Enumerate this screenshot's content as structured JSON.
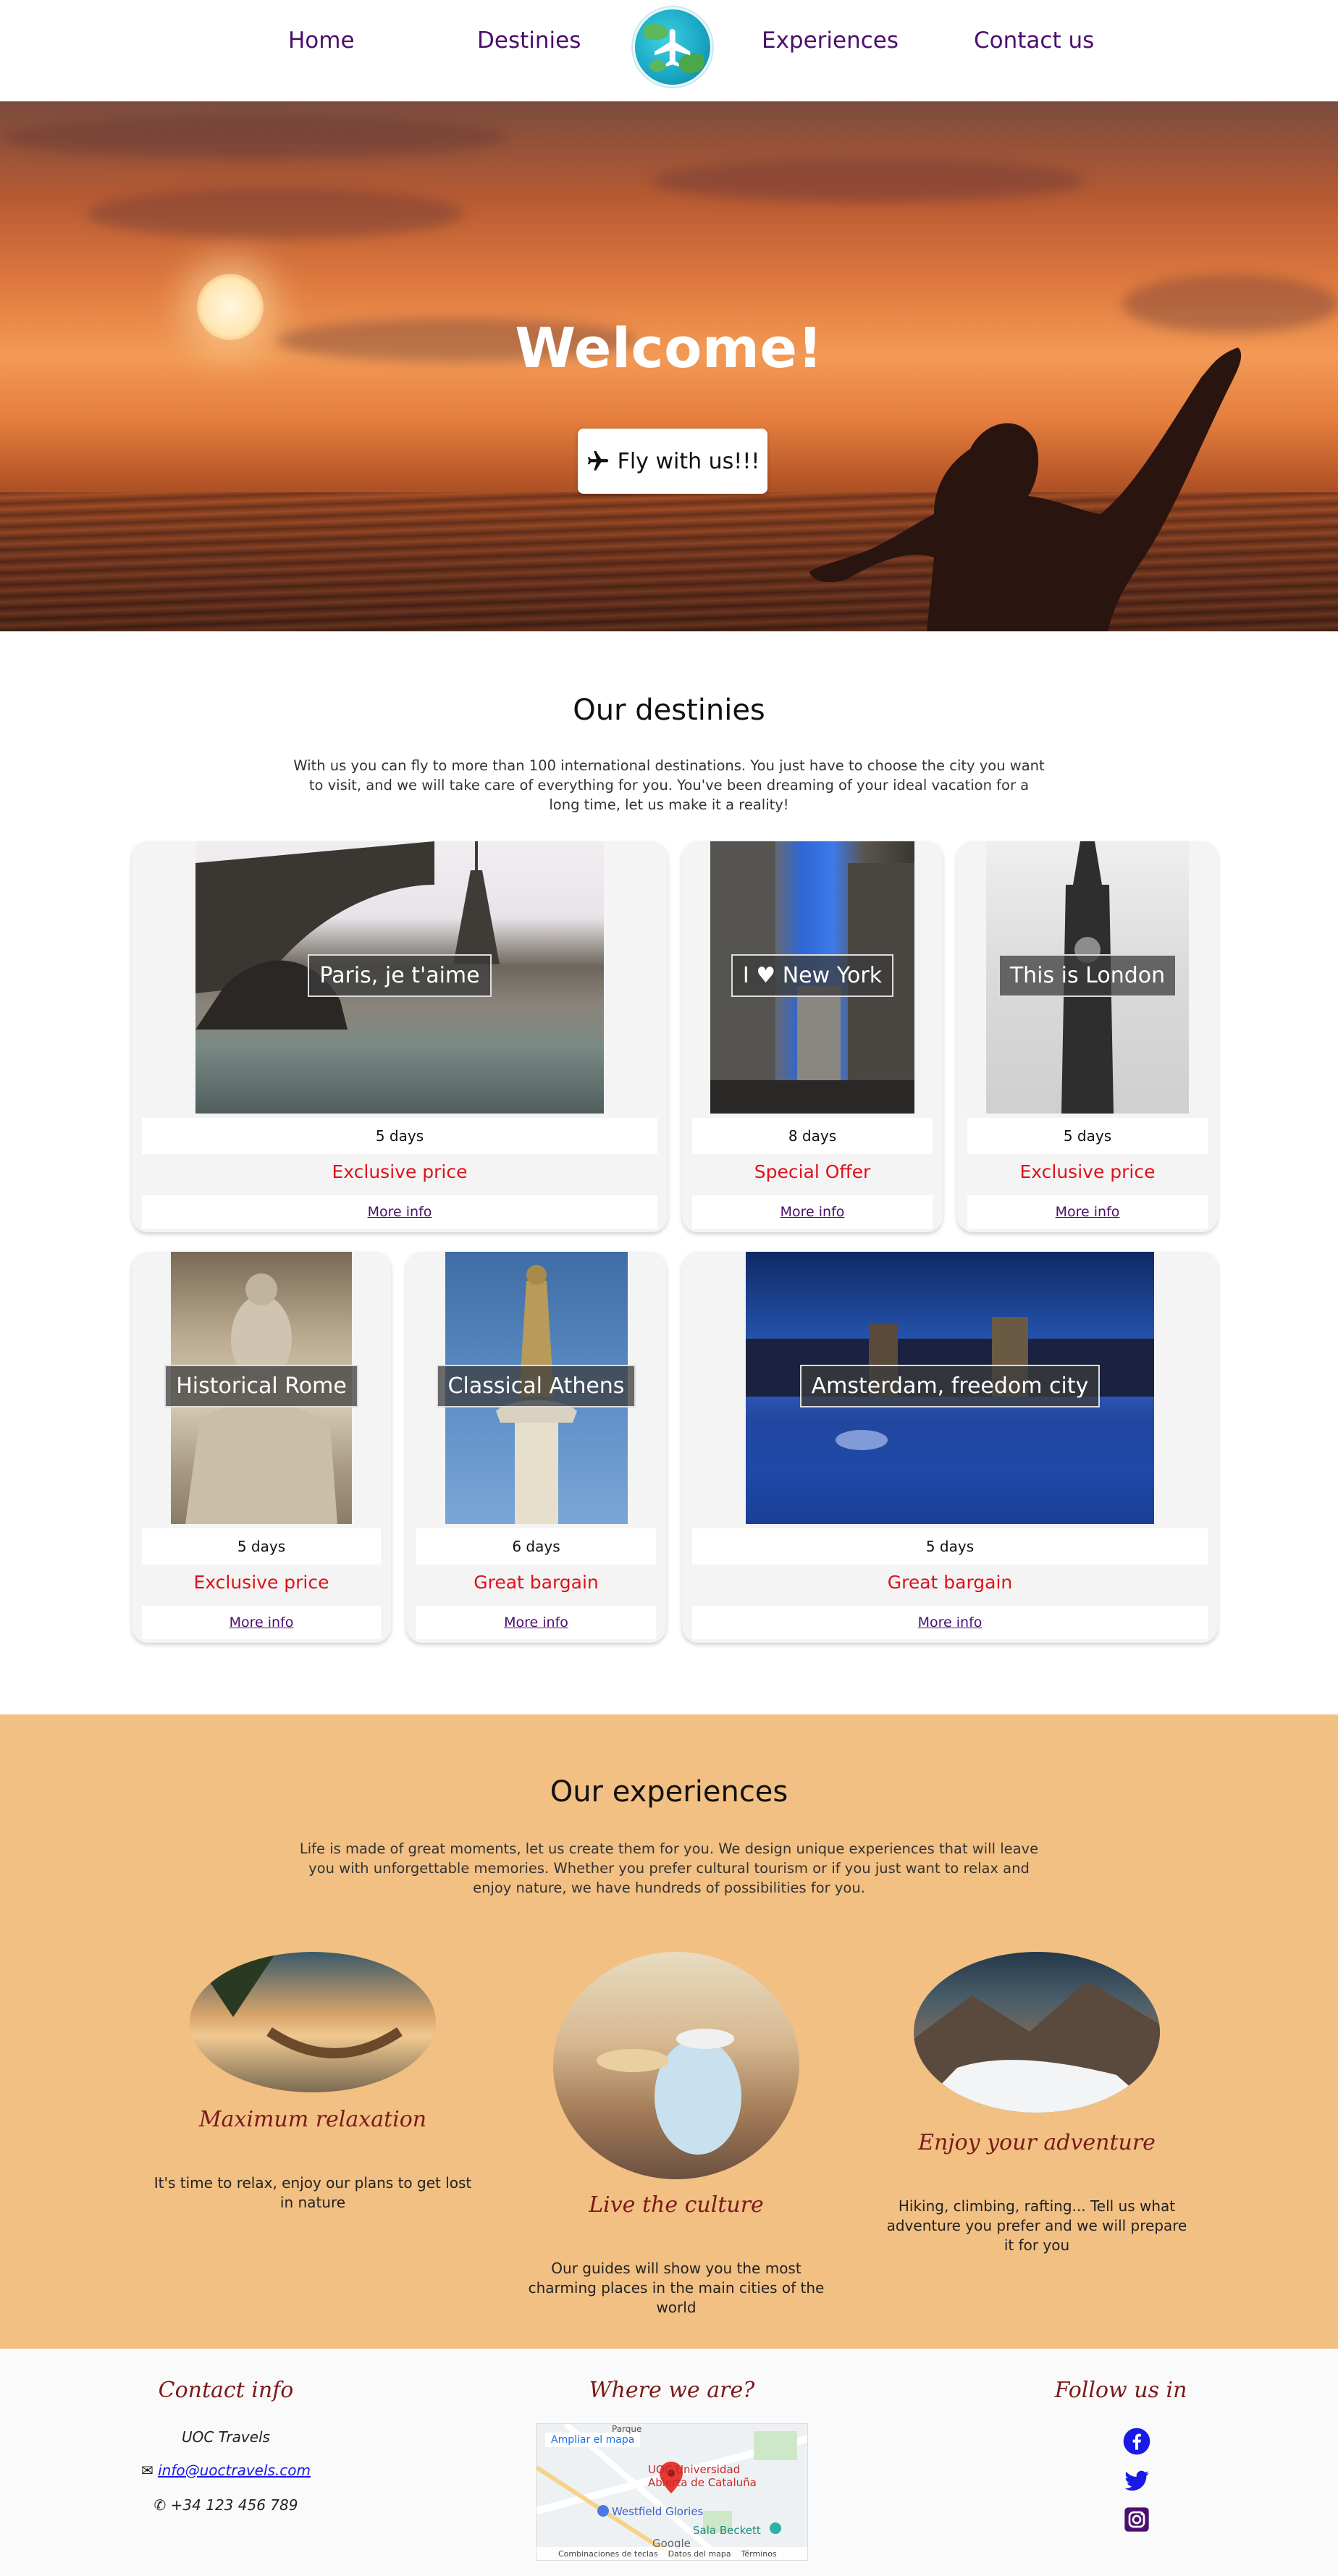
{
  "nav": {
    "links": [
      "Home",
      "Destinies",
      "Experiences",
      "Contact us"
    ]
  },
  "hero": {
    "title": "Welcome!",
    "button": "Fly with us!!!"
  },
  "destinies": {
    "title": "Our destinies",
    "text": "With us you can fly to more than 100 international destinations. You just have to choose the city you want to visit, and we will take care of everything for you. You've been dreaming of your ideal vacation for a long time, let us make it a reality!",
    "cards": [
      {
        "caption": "Paris, je t'aime",
        "days": "5 days",
        "price": "Exclusive price",
        "more": "More info"
      },
      {
        "caption": "I ♥ New York",
        "days": "8 days",
        "price": "Special Offer",
        "more": "More info"
      },
      {
        "caption": "This is London",
        "days": "5 days",
        "price": "Exclusive price",
        "more": "More info"
      },
      {
        "caption": "Historical Rome",
        "days": "5 days",
        "price": "Exclusive price",
        "more": "More info"
      },
      {
        "caption": "Classical Athens",
        "days": "6 days",
        "price": "Great bargain",
        "more": "More info"
      },
      {
        "caption": "Amsterdam, freedom city",
        "days": "5 days",
        "price": "Great bargain",
        "more": "More info"
      }
    ]
  },
  "experiences": {
    "title": "Our experiences",
    "text": "Life is made of great moments, let us create them for you. We design unique experiences that will leave you with unforgettable memories. Whether you prefer cultural tourism or if you just want to relax and enjoy nature, we have hundreds of possibilities for you.",
    "items": [
      {
        "title": "Maximum relaxation",
        "text": "It's time to relax, enjoy our plans to get lost in nature"
      },
      {
        "title": "Live the culture",
        "text": "Our guides will show you the most charming places in the main cities of the world"
      },
      {
        "title": "Enjoy your adventure",
        "text": "Hiking, climbing, rafting... Tell us what adventure you prefer and we will prepare it for you"
      }
    ]
  },
  "footer": {
    "contact_title": "Contact info",
    "company": "UOC Travels",
    "email": "info@uoctravels.com",
    "phone": "+34 123 456 789",
    "map_title": "Where we are?",
    "map_link": "Ampliar el mapa",
    "map_place": "UOC Universidad Abierta de Cataluña",
    "map_poi1": "Westfield Glories",
    "map_poi2": "Sala Beckett",
    "map_street": "Parque",
    "map_footer": [
      "Combinaciones de teclas",
      "Datos del mapa",
      "Términos"
    ],
    "map_brand": "Google",
    "follow_title": "Follow us in"
  },
  "colors": {
    "nav_link": "#4b0f6e",
    "price": "#e0101a",
    "experiences_bg": "#f2c083",
    "script_heading": "#7a1a1a"
  }
}
